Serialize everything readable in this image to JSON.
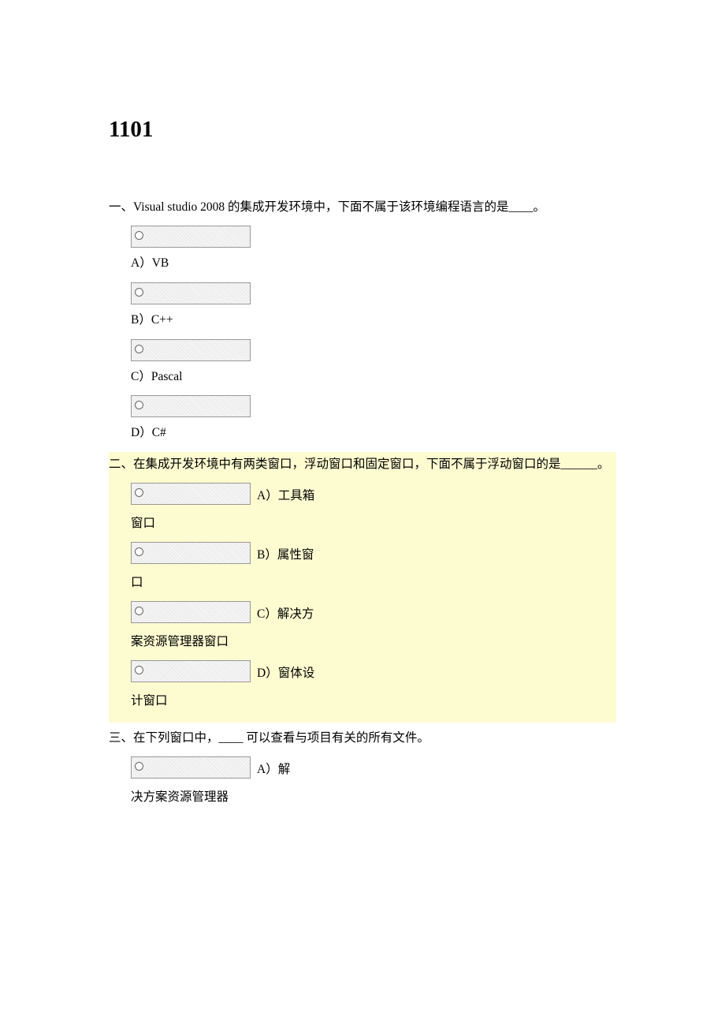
{
  "title": "1101",
  "questions": [
    {
      "text": "一、Visual studio 2008 的集成开发环境中，下面不属于该环境编程语言的是____。",
      "options": [
        "A）VB",
        "B）C++",
        "C）Pascal",
        "D）C#"
      ]
    },
    {
      "text": "二、在集成开发环境中有两类窗口，浮动窗口和固定窗口，下面不属于浮动窗口的是______。",
      "options": [
        {
          "prefix": "A）工具箱",
          "wrap": "窗口"
        },
        {
          "prefix": "B）属性窗",
          "wrap": "口"
        },
        {
          "prefix": "C）解决方",
          "wrap": "案资源管理器窗口"
        },
        {
          "prefix": "D）窗体设",
          "wrap": "计窗口"
        }
      ]
    },
    {
      "text": "三、在下列窗口中，____ 可以查看与项目有关的所有文件。",
      "options": [
        {
          "prefix": "A）解",
          "wrap": "决方案资源管理器"
        }
      ]
    }
  ]
}
